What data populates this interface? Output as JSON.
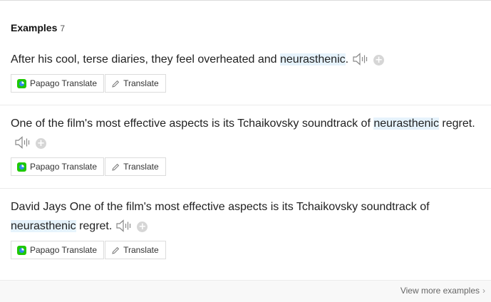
{
  "header": {
    "title": "Examples",
    "count": "7"
  },
  "examples": [
    {
      "before": "After his cool, terse diaries, they feel overheated and ",
      "highlight": "neurasthenic",
      "after": "."
    },
    {
      "before": "One of the film's most effective aspects is its Tchaikovsky soundtrack of ",
      "highlight": "neurasthenic",
      "after": " regret."
    },
    {
      "before": "David Jays One of the film's most effective aspects is its Tchaikovsky soundtrack of ",
      "highlight": "neurasthenic",
      "after": " regret."
    }
  ],
  "buttons": {
    "papago": "Papago Translate",
    "translate": "Translate"
  },
  "footer": {
    "more": "View more examples"
  },
  "colors": {
    "highlight": "#e6f3fc",
    "papago_green": "#1ec800",
    "papago_blue": "#2e8bea"
  }
}
